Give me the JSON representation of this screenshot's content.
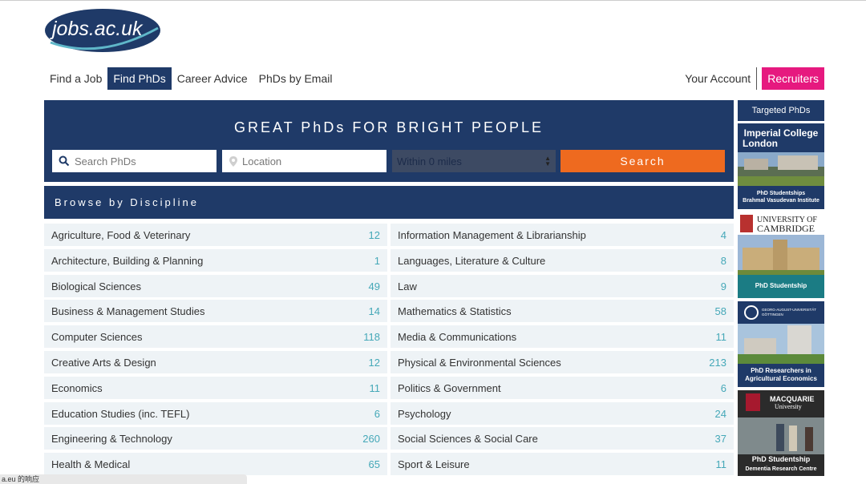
{
  "logo": {
    "text": "jobs.ac.uk"
  },
  "nav": {
    "items": [
      {
        "label": "Find a Job",
        "active": false
      },
      {
        "label": "Find PhDs",
        "active": true
      },
      {
        "label": "Career Advice",
        "active": false
      },
      {
        "label": "PhDs by Email",
        "active": false
      }
    ],
    "account_label": "Your Account",
    "recruiters_label": "Recruiters"
  },
  "hero": {
    "title": "GREAT PhDs FOR BRIGHT PEOPLE",
    "search_placeholder": "Search PhDs",
    "location_placeholder": "Location",
    "within_value": "Within 0 miles",
    "search_button": "Search"
  },
  "browse": {
    "title": "Browse by Discipline",
    "left": [
      {
        "label": "Agriculture, Food & Veterinary",
        "count": "12"
      },
      {
        "label": "Architecture, Building & Planning",
        "count": "1"
      },
      {
        "label": "Biological Sciences",
        "count": "49"
      },
      {
        "label": "Business & Management Studies",
        "count": "14"
      },
      {
        "label": "Computer Sciences",
        "count": "118"
      },
      {
        "label": "Creative Arts & Design",
        "count": "12"
      },
      {
        "label": "Economics",
        "count": "11"
      },
      {
        "label": "Education Studies (inc. TEFL)",
        "count": "6"
      },
      {
        "label": "Engineering & Technology",
        "count": "260"
      },
      {
        "label": "Health & Medical",
        "count": "65"
      }
    ],
    "right": [
      {
        "label": "Information Management & Librarianship",
        "count": "4"
      },
      {
        "label": "Languages, Literature & Culture",
        "count": "8"
      },
      {
        "label": "Law",
        "count": "9"
      },
      {
        "label": "Mathematics & Statistics",
        "count": "58"
      },
      {
        "label": "Media & Communications",
        "count": "11"
      },
      {
        "label": "Physical & Environmental Sciences",
        "count": "213"
      },
      {
        "label": "Politics & Government",
        "count": "6"
      },
      {
        "label": "Psychology",
        "count": "24"
      },
      {
        "label": "Social Sciences & Social Care",
        "count": "37"
      },
      {
        "label": "Sport & Leisure",
        "count": "11"
      }
    ]
  },
  "sidebar": {
    "heading": "Targeted PhDs",
    "ads": [
      {
        "org": "Imperial College London",
        "caption1": "PhD Studentships",
        "caption2": "Brahmal Vasudevan Institute"
      },
      {
        "org": "UNIVERSITY OF CAMBRIDGE",
        "caption1": "PhD Studentship",
        "caption2": ""
      },
      {
        "org": "GEORG-AUGUST-UNIVERSITÄT GÖTTINGEN",
        "caption1": "PhD Researchers in",
        "caption2": "Agricultural Economics"
      },
      {
        "org": "MACQUARIE University",
        "caption1": "PhD Studentship",
        "caption2": "Dementia Research Centre"
      }
    ]
  },
  "statusbar": {
    "text": "a.eu 的响应"
  },
  "colors": {
    "navy": "#1f3a68",
    "orange": "#ee6a1f",
    "pink": "#e6197f",
    "teal": "#45a8b8",
    "row_bg": "#eef3f6"
  }
}
